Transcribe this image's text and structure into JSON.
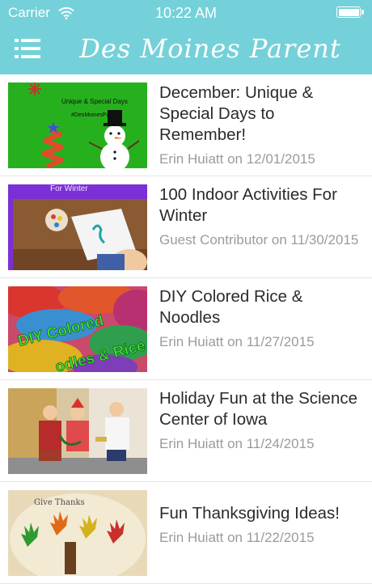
{
  "status_bar": {
    "carrier": "Carrier",
    "time": "10:22 AM"
  },
  "header": {
    "title": "Des Moines Parent",
    "menu_icon": "hamburger-menu-icon"
  },
  "colors": {
    "header_bg": "#74d1d9",
    "title_text": "#2b2b2b",
    "meta_text": "#9b9b9b"
  },
  "articles": [
    {
      "title": "December: Unique & Special Days to Remember!",
      "meta": "Erin Huiatt on 12/01/2015",
      "thumb_line1": "Unique & Special Days",
      "thumb_line2": "#DesMoinesParent"
    },
    {
      "title": "100 Indoor Activities For Winter",
      "meta": "Guest Contributor on 11/30/2015",
      "thumb_text": "For Winter"
    },
    {
      "title": "DIY Colored Rice & Noodles",
      "meta": "Erin Huiatt on 11/27/2015",
      "thumb_line1": "DIY Colored",
      "thumb_line2": "odles & Rice"
    },
    {
      "title": "Holiday Fun at the Science Center of Iowa",
      "meta": "Erin Huiatt on 11/24/2015"
    },
    {
      "title": "Fun Thanksgiving Ideas!",
      "meta": "Erin Huiatt on 11/22/2015",
      "thumb_text": "Give Thanks"
    }
  ]
}
